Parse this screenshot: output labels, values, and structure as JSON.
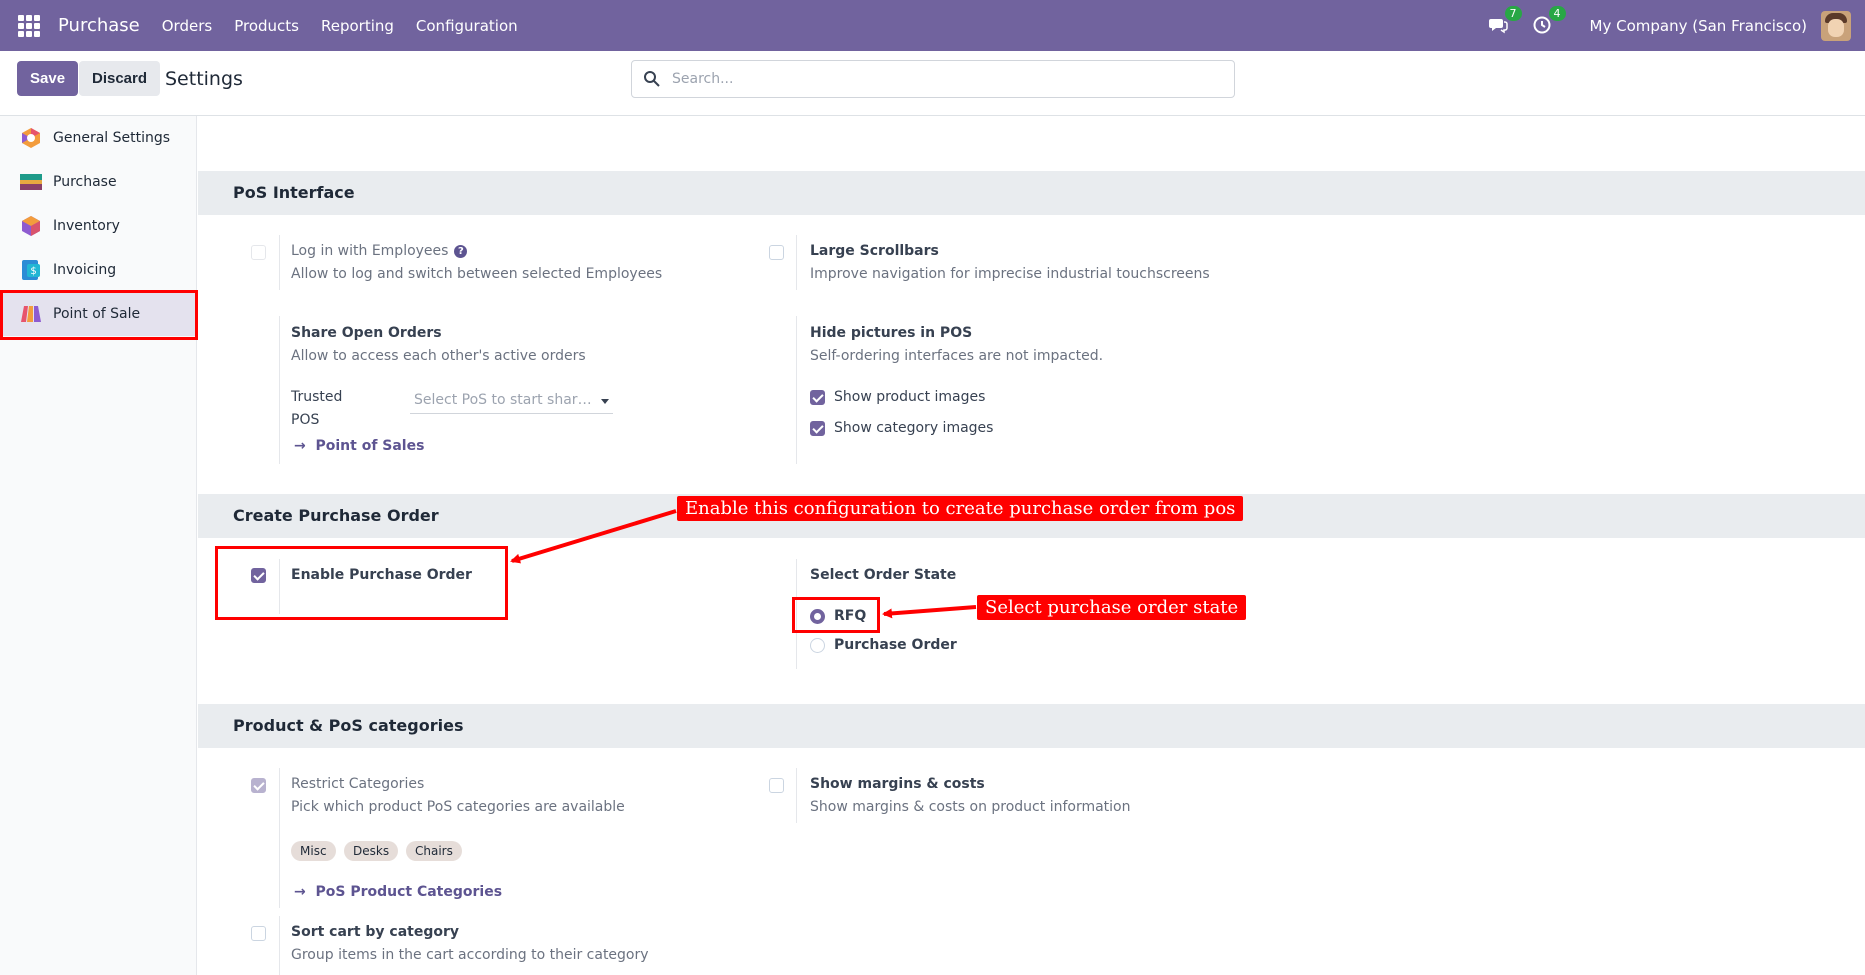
{
  "navbar": {
    "brand": "Purchase",
    "menu": [
      "Orders",
      "Products",
      "Reporting",
      "Configuration"
    ],
    "messages_count": "7",
    "activities_count": "4",
    "company": "My Company (San Francisco)"
  },
  "control": {
    "save_label": "Save",
    "discard_label": "Discard",
    "title": "Settings",
    "search_placeholder": "Search..."
  },
  "sidebar": {
    "items": [
      {
        "label": "General Settings",
        "icon": "general-settings-icon"
      },
      {
        "label": "Purchase",
        "icon": "purchase-app-icon"
      },
      {
        "label": "Inventory",
        "icon": "inventory-app-icon"
      },
      {
        "label": "Invoicing",
        "icon": "invoicing-app-icon"
      },
      {
        "label": "Point of Sale",
        "icon": "point-of-sale-app-icon"
      }
    ]
  },
  "pos_interface": {
    "header": "PoS Interface",
    "login_employees": {
      "label": "Log in with Employees",
      "desc": "Allow to log and switch between selected Employees",
      "checked": false
    },
    "large_scrollbars": {
      "label": "Large Scrollbars",
      "desc": "Improve navigation for imprecise industrial touchscreens",
      "checked": false
    },
    "share_open_orders": {
      "label": "Share Open Orders",
      "desc": "Allow to access each other's active orders"
    },
    "trusted_pos_label_1": "Trusted",
    "trusted_pos_label_2": "POS",
    "trusted_pos_placeholder": "Select PoS to start shari...",
    "point_of_sales_link": "Point of Sales",
    "hide_pictures": {
      "label": "Hide pictures in POS",
      "desc": "Self-ordering interfaces are not impacted."
    },
    "show_product_images": {
      "label": "Show product images",
      "checked": true
    },
    "show_category_images": {
      "label": "Show category images",
      "checked": true
    }
  },
  "create_po": {
    "header": "Create Purchase Order",
    "enable_po": {
      "label": "Enable Purchase Order",
      "checked": true
    },
    "order_state_label": "Select Order State",
    "states": [
      {
        "label": "RFQ",
        "selected": true
      },
      {
        "label": "Purchase Order",
        "selected": false
      }
    ]
  },
  "product_categories": {
    "header": "Product & PoS categories",
    "restrict": {
      "label": "Restrict Categories",
      "desc": "Pick which product PoS categories are available",
      "checked": true
    },
    "tags": [
      "Misc",
      "Desks",
      "Chairs"
    ],
    "categories_link": "PoS Product Categories",
    "margins": {
      "label": "Show margins & costs",
      "desc": "Show margins & costs on product information",
      "checked": false
    },
    "sort_cart": {
      "label": "Sort cart by category",
      "desc": "Group items in the cart according to their category",
      "checked": false
    }
  },
  "annotations": {
    "enable_note": "Enable this configuration to create purchase order from pos",
    "state_note": "Select purchase order state"
  },
  "colors": {
    "brand": "#71639e",
    "annotation": "#ff0000",
    "badge": "#28a745"
  }
}
